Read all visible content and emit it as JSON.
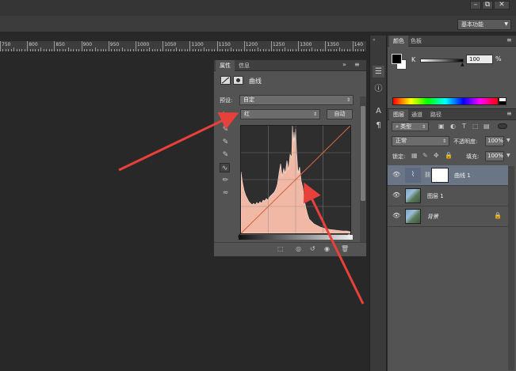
{
  "window": {
    "minimize_icon": "minimize-icon",
    "restore_icon": "restore-icon",
    "close_icon": "close-icon",
    "minimize_glyph": "–",
    "restore_glyph": "⧉",
    "close_glyph": "✕"
  },
  "workspace": {
    "value": "基本功能"
  },
  "ruler": {
    "labels": [
      "750",
      "800",
      "850",
      "900",
      "950",
      "1000",
      "1050",
      "1100",
      "1150",
      "1200",
      "1250",
      "1300",
      "1350",
      "140"
    ]
  },
  "properties": {
    "tabs": [
      "属性",
      "信息"
    ],
    "collapse_glyph": "»",
    "menu_glyph": "≡",
    "title": "曲线",
    "preset_label": "预设:",
    "preset_value": "自定",
    "channel_value": "红",
    "auto_button": "自动"
  },
  "color_panel": {
    "tabs": [
      "颜色",
      "色板"
    ],
    "channel_label": "K",
    "value": "100",
    "unit": "%"
  },
  "layers_panel": {
    "tabs": [
      "图层",
      "通道",
      "路径"
    ],
    "filter_value": "类型",
    "blend_mode": "正常",
    "opacity_label": "不透明度:",
    "opacity_value": "100%",
    "lock_label": "锁定:",
    "fill_label": "填充:",
    "fill_value": "100%",
    "layers": [
      {
        "name": "曲线 1",
        "selected": true
      },
      {
        "name": "图层 1",
        "selected": false
      },
      {
        "name": "背景",
        "selected": false
      }
    ]
  },
  "colors": {
    "accent_arrow": "#e8403a",
    "histogram_fill": "#f2b8a6",
    "curve_line": "#d8603c",
    "selected_layer": "#6a7585"
  }
}
